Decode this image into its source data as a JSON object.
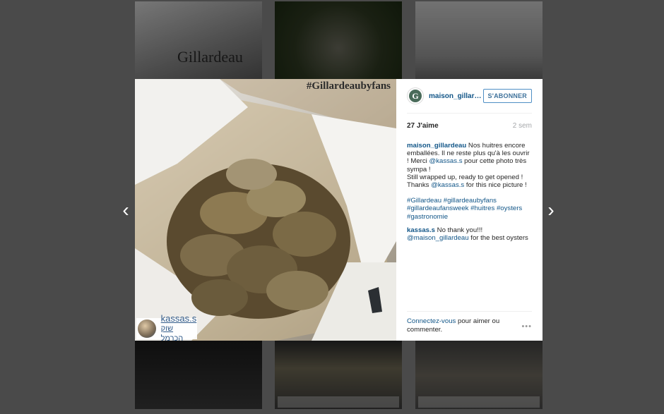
{
  "grid": {
    "top_left_text": "Gillardeau"
  },
  "post": {
    "image_hashtag": "#Gillardeaubyfans",
    "tag_user": "kassas.s",
    "tag_location": "שוק הכרמל",
    "header": {
      "username": "maison_gillardeau",
      "follow_label": "S'ABONNER"
    },
    "likes": "27 J'aime",
    "time": "2 sem",
    "comments": [
      {
        "user": "maison_gillardeau",
        "t1": " Nos huitres encore emballées. Il ne reste plus qu'à les ouvrir ! Merci ",
        "m1": "@kassas.s",
        "t2": " pour cette photo très sympa !",
        "t3": "Still wrapped up, ready to get opened ! Thanks ",
        "m2": "@kassas.s",
        "t4": " for this nice picture !",
        "tags": [
          "#Gillardeau",
          "#gillardeaubyfans",
          "#gillardeaufansweek",
          "#huitres",
          "#oysters",
          "#gastronomie"
        ]
      },
      {
        "user": "kassas.s",
        "t1": " No thank you!!!",
        "m1": "@maison_gillardeau",
        "t2": " for the best oysters"
      }
    ],
    "footer": {
      "login_link": "Connectez-vous",
      "login_rest": " pour aimer ou commenter.",
      "more": "•••"
    }
  },
  "nav": {
    "prev": "‹",
    "next": "›"
  }
}
